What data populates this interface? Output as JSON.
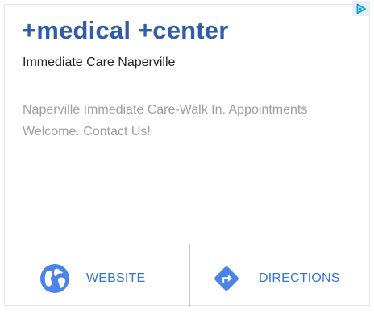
{
  "ad": {
    "headline": "+medical +center",
    "advertiser": "Immediate Care Naperville",
    "description": "Naperville Immediate Care-Walk In. Appointments Welcome. Contact Us!",
    "adchoices_icon": "adchoices-icon"
  },
  "actions": {
    "website": {
      "label": "WEBSITE",
      "icon": "globe-icon"
    },
    "directions": {
      "label": "DIRECTIONS",
      "icon": "directions-icon"
    }
  },
  "colors": {
    "headline": "#2f5da8",
    "action_text": "#3575d6",
    "icon_blue": "#4a84e8",
    "description": "#9e9e9e",
    "adchoices": "#1aa3d8"
  }
}
